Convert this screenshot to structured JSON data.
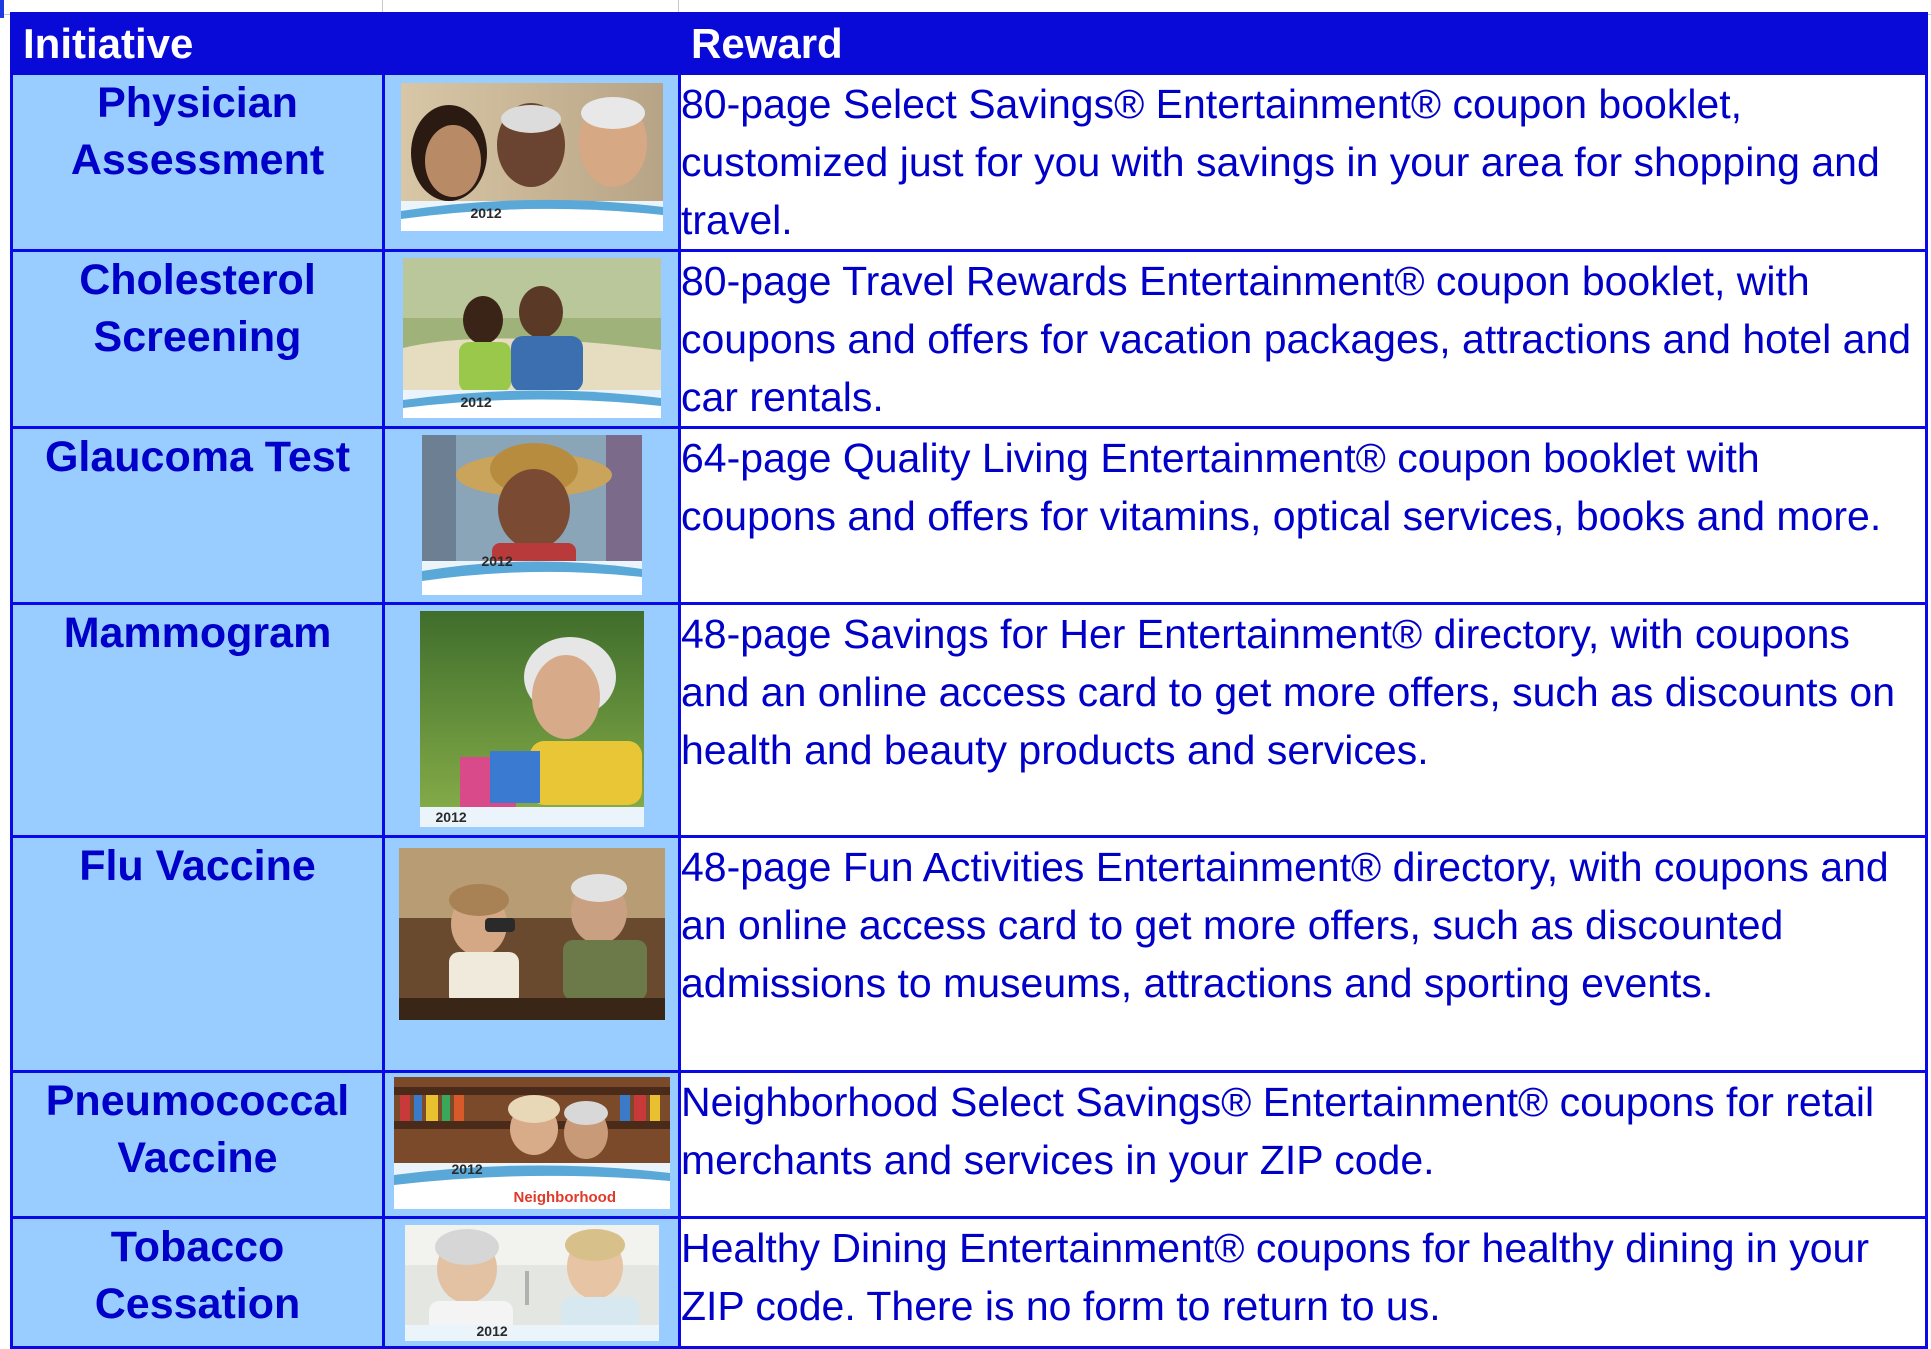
{
  "header": {
    "initiative_label": "Initiative",
    "reward_label": "Reward"
  },
  "rows": [
    {
      "initiative": "Physician Assessment",
      "reward": "80-page Select Savings® Entertainment® coupon booklet, customized just for you with savings in your area for shopping and travel.",
      "image_year": "2012",
      "image": "three-seniors-smiling-photo"
    },
    {
      "initiative": "Cholesterol Screening",
      "reward": "80-page Travel Rewards Entertainment® coupon booklet, with coupons and offers for vacation packages, attractions and hotel and car rentals.",
      "image_year": "2012",
      "image": "couple-at-beach-photo"
    },
    {
      "initiative": "Glaucoma Test",
      "reward": "64-page Quality Living Entertainment® coupon booklet with coupons and offers for vitamins, optical services, books and more.",
      "image_year": "2012",
      "image": "woman-in-straw-hat-photo"
    },
    {
      "initiative": "Mammogram",
      "reward": "48-page Savings for Her Entertainment® directory, with coupons and an online access card to get more offers, such as discounts on health and beauty products and services.",
      "image_year": "2012",
      "image": "older-woman-with-shopping-bags-photo"
    },
    {
      "initiative": "Flu Vaccine",
      "reward": "48-page Fun Activities Entertainment® directory, with coupons and an online access card to get more offers, such as discounted admissions to museums, attractions and sporting events.",
      "image_year": "",
      "image": "couple-with-binoculars-photo"
    },
    {
      "initiative": "Pneumococcal Vaccine",
      "reward": "Neighborhood Select Savings® Entertainment® coupons for retail merchants and services in your ZIP code.",
      "image_year": "2012",
      "image_brand": "Neighborhood",
      "image": "couple-in-bookstore-photo"
    },
    {
      "initiative": "Tobacco Cessation",
      "reward": "Healthy Dining Entertainment® coupons for healthy dining in your ZIP code. There is no form to return to us.",
      "image_year": "2012",
      "image": "couple-dining-photo"
    }
  ],
  "colors": {
    "header_bg": "#0a0ad8",
    "header_text": "#ffffff",
    "initiative_bg": "#99ccff",
    "text_blue": "#0000c8",
    "border": "#0a0ae8"
  }
}
